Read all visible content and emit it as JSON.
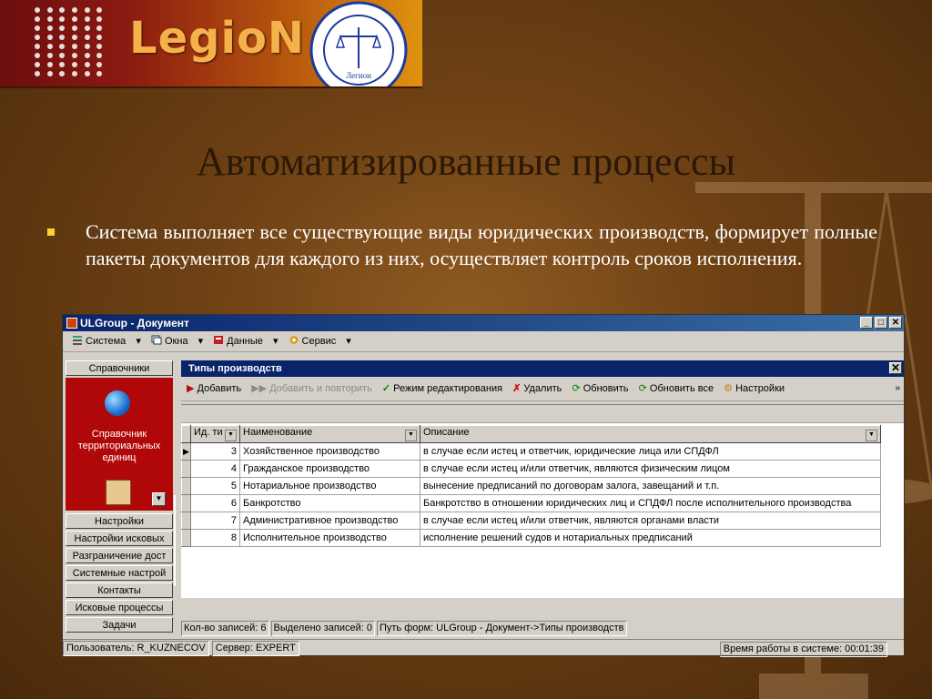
{
  "brand": {
    "logo_text": "LegioN",
    "seal_text": "Легион"
  },
  "slide": {
    "title": "Автоматизированные процессы",
    "bullet": "Система выполняет все существующие виды юридических производств, формирует полные пакеты документов для  каждого из них, осуществляет контроль сроков исполнения."
  },
  "window": {
    "title": "ULGroup - Документ",
    "menu": [
      "Система",
      "Окна",
      "Данные",
      "Сервис"
    ],
    "sidebar": {
      "top_button": "Справочники",
      "panel_label": "Справочник территориальных единиц",
      "buttons": [
        "Настройки",
        "Настройки исковых",
        "Разграничение дост",
        "Системные настрой",
        "Контакты",
        "Исковые процессы",
        "Задачи"
      ]
    },
    "panel": {
      "title": "Типы производств",
      "toolbar": {
        "add": "Добавить",
        "add_repeat": "Добавить и повторить",
        "edit_mode": "Режим редактирования",
        "delete": "Удалить",
        "refresh": "Обновить",
        "refresh_all": "Обновить все",
        "settings": "Настройки"
      },
      "columns": [
        "Ид. ти",
        "Наименование",
        "Описание"
      ],
      "rows": [
        {
          "id": "3",
          "name": "Хозяйственное производство",
          "desc": "в случае если истец и ответчик, юридические лица или СПДФЛ"
        },
        {
          "id": "4",
          "name": "Гражданское производство",
          "desc": "в случае если истец и/или ответчик, являются физическим лицом"
        },
        {
          "id": "5",
          "name": "Нотариальное производство",
          "desc": "вынесение предписаний по договорам залога, завещаний и т.п."
        },
        {
          "id": "6",
          "name": "Банкротство",
          "desc": "Банкротство в отношении юридических лиц и СПДФЛ после исполнительного производства"
        },
        {
          "id": "7",
          "name": "Административное производство",
          "desc": "в случае если истец и/или ответчик, являются органами власти"
        },
        {
          "id": "8",
          "name": "Исполнительное производство",
          "desc": "исполнение решений судов и нотариальных предписаний"
        }
      ],
      "status": {
        "count": "Кол-во записей: 6",
        "selected": "Выделено записей: 0",
        "path": "Путь форм: ULGroup - Документ->Типы производств"
      }
    },
    "bottom": {
      "user": "Пользователь: R_KUZNECOV",
      "server": "Сервер: EXPERT",
      "uptime": "Время работы в системе: 00:01:39"
    }
  }
}
